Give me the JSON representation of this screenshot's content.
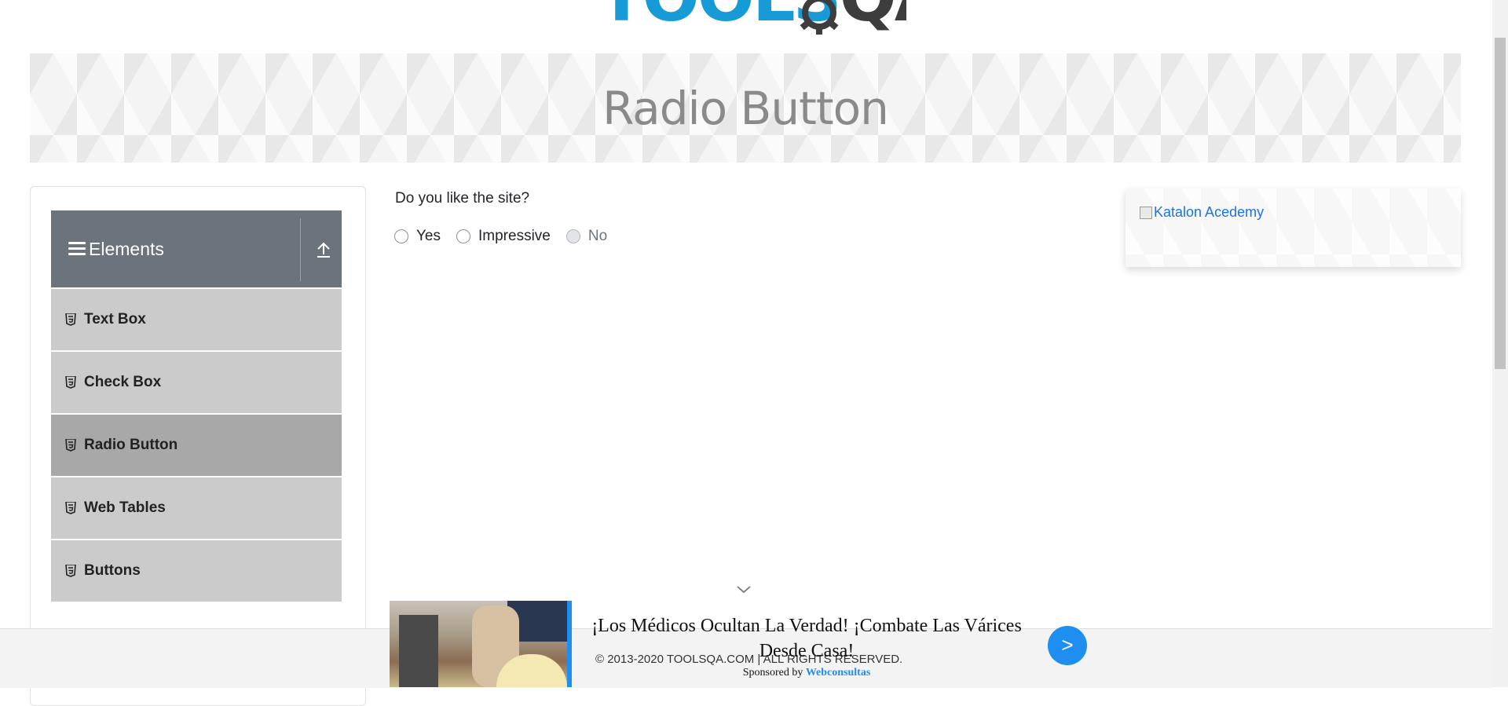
{
  "logo": {
    "part1": "TOOLS",
    "part2": "QA"
  },
  "banner": {
    "title": "Radio Button"
  },
  "sidebar": {
    "group_title": "Elements",
    "group_icon": "hamburger-icon",
    "collapse_icon": "upload-arrow-icon",
    "items": [
      {
        "label": "Text Box",
        "icon": "html5-icon",
        "active": false
      },
      {
        "label": "Check Box",
        "icon": "html5-icon",
        "active": false
      },
      {
        "label": "Radio Button",
        "icon": "html5-icon",
        "active": true
      },
      {
        "label": "Web Tables",
        "icon": "html5-icon",
        "active": false
      },
      {
        "label": "Buttons",
        "icon": "html5-icon",
        "active": false
      }
    ]
  },
  "main": {
    "question": "Do you like the site?",
    "options": [
      {
        "label": "Yes",
        "checked": false,
        "disabled": false
      },
      {
        "label": "Impressive",
        "checked": false,
        "disabled": false
      },
      {
        "label": "No",
        "checked": false,
        "disabled": true
      }
    ]
  },
  "ad_panel": {
    "image_alt": "Katalon Acedemy"
  },
  "sticky_ad": {
    "headline": "¡Los Médicos Ocultan La Verdad! ¡Combate Las Várices Desde Casa!",
    "sponsor_prefix": "Sponsored by",
    "sponsor_name": "Webconsultas",
    "button_label": ">",
    "accent_color": "#1e8ef0"
  },
  "footer": {
    "copyright": "© 2013-2020 TOOLSQA.COM | ALL RIGHTS RESERVED."
  },
  "colors": {
    "sidebar_header": "#6b747c",
    "menu_item": "#cbcbcb",
    "menu_item_active": "#a8a8a8",
    "logo_blue": "#169bd6"
  }
}
